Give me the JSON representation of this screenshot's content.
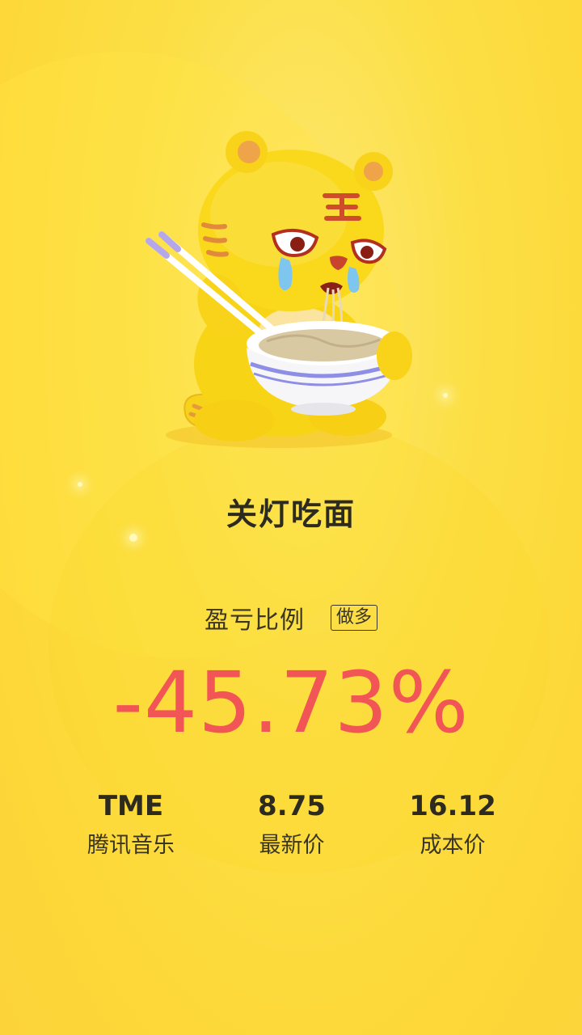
{
  "title": "关灯吃面",
  "ratio": {
    "label": "盈亏比例",
    "tag": "做多",
    "value": "-45.73%"
  },
  "stats": [
    {
      "value": "TME",
      "label": "腾讯音乐"
    },
    {
      "value": "8.75",
      "label": "最新价"
    },
    {
      "value": "16.12",
      "label": "成本价"
    }
  ],
  "colors": {
    "background": "#fcdb3f",
    "loss_red": "#f25555",
    "text_dark": "#2d2a1f"
  },
  "illustration": "crying-tiger-eating-noodles"
}
